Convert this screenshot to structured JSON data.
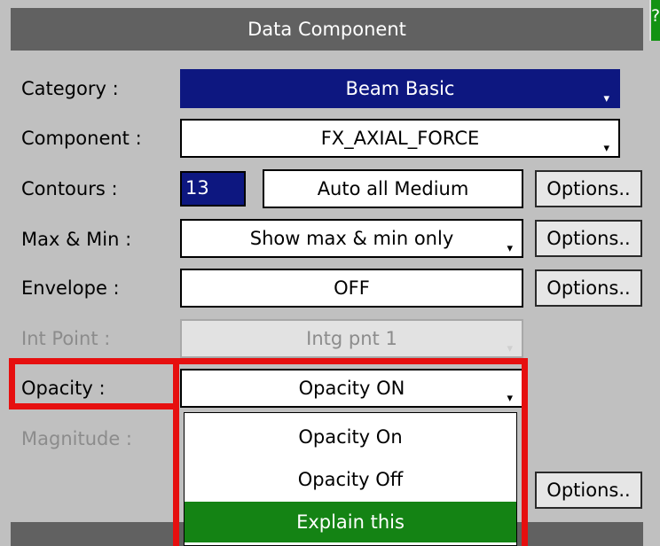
{
  "title": "Data Component",
  "help_label": "?",
  "rows": {
    "category": {
      "label": "Category :",
      "value": "Beam Basic"
    },
    "component": {
      "label": "Component :",
      "value": "FX_AXIAL_FORCE"
    },
    "contours": {
      "label": "Contours :",
      "count": "13",
      "value": "Auto all Medium",
      "options": "Options.."
    },
    "maxmin": {
      "label": "Max & Min :",
      "value": "Show max & min only",
      "options": "Options.."
    },
    "envelope": {
      "label": "Envelope :",
      "value": "OFF",
      "options": "Options.."
    },
    "intpoint": {
      "label": "Int Point :",
      "value": "Intg pnt 1"
    },
    "opacity": {
      "label": "Opacity :",
      "value": "Opacity ON"
    },
    "magnitude": {
      "label": "Magnitude :",
      "options": "Options.."
    }
  },
  "dropdown": {
    "items": [
      "Opacity On",
      "Opacity Off",
      "Explain this"
    ],
    "selected": "Explain this"
  },
  "colors": {
    "title_bar": "#616161",
    "dark_field": "#0d1780",
    "highlight": "#148314",
    "callout": "#e60f0f"
  },
  "icons": {
    "dropdown_arrow": "▾"
  }
}
